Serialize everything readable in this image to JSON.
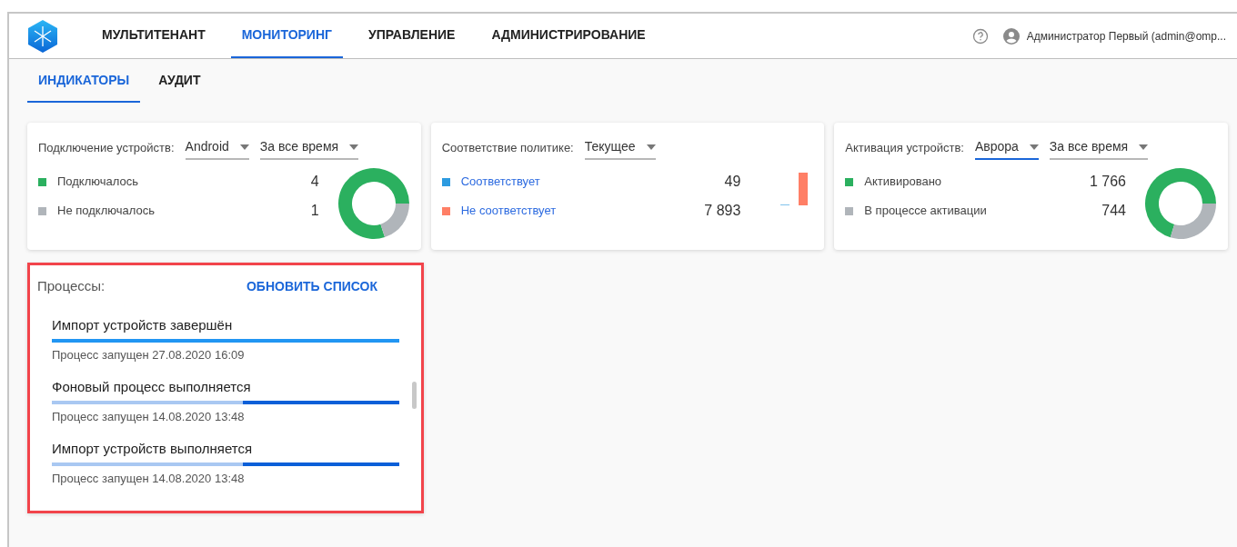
{
  "nav": [
    {
      "label": "МУЛЬТИТЕНАНТ",
      "selected": false
    },
    {
      "label": "МОНИТОРИНГ",
      "selected": true
    },
    {
      "label": "УПРАВЛЕНИЕ",
      "selected": false
    },
    {
      "label": "АДМИНИСТРИРОВАНИЕ",
      "selected": false
    }
  ],
  "user": {
    "name": "Администратор Первый (admin@omp..."
  },
  "subtabs": [
    {
      "label": "ИНДИКАТОРЫ",
      "selected": true
    },
    {
      "label": "АУДИТ",
      "selected": false
    }
  ],
  "cards": [
    {
      "title": "Подключение устройств:",
      "selects": [
        {
          "value": "Android",
          "focused": false
        },
        {
          "value": "За все время",
          "focused": false
        }
      ],
      "legend": [
        {
          "color": "#2bb05f",
          "link": false
        },
        {
          "color": "#b0b5ba",
          "link": false
        }
      ],
      "chart_data": {
        "type": "donut",
        "categories": [
          "Подключалось",
          "Не подключалось"
        ],
        "values": [
          4,
          1
        ],
        "value_labels": [
          "4",
          "1"
        ],
        "legend": "left"
      }
    },
    {
      "title": "Соответствие политике:",
      "selects": [
        {
          "value": "Текущее",
          "focused": false
        }
      ],
      "kind": "bars",
      "legend": [
        {
          "label": "Соответствует",
          "value": "49",
          "color": "#2d9be0",
          "link": true
        },
        {
          "label": "Не соответствует",
          "value": "7 893",
          "color": "#ff7f66",
          "link": true
        }
      ]
    },
    {
      "title": "Активация устройств:",
      "selects": [
        {
          "value": "Аврора",
          "focused": true
        },
        {
          "value": "За все время",
          "focused": false
        }
      ],
      "legend": [
        {
          "color": "#2bb05f",
          "link": false
        },
        {
          "color": "#b0b5ba",
          "link": false
        }
      ],
      "chart_data": {
        "type": "donut",
        "categories": [
          "Активировано",
          "В процессе активации"
        ],
        "values": [
          1766,
          744
        ],
        "value_labels": [
          "1 766",
          "744"
        ],
        "legend": "left"
      }
    }
  ],
  "processes": {
    "title": "Процессы:",
    "refresh": "ОБНОВИТЬ СПИСОК",
    "highlighted": true,
    "items": [
      {
        "title": "Импорт устройств завершён",
        "started": "Процесс запущен 27.08.2020 16:09",
        "kind": "done"
      },
      {
        "title": "Фоновый процесс выполняется",
        "started": "Процесс запущен 14.08.2020 13:48",
        "kind": "running"
      },
      {
        "title": "Импорт устройств выполняется",
        "started": "Процесс запущен 14.08.2020 13:48",
        "kind": "running"
      }
    ]
  }
}
